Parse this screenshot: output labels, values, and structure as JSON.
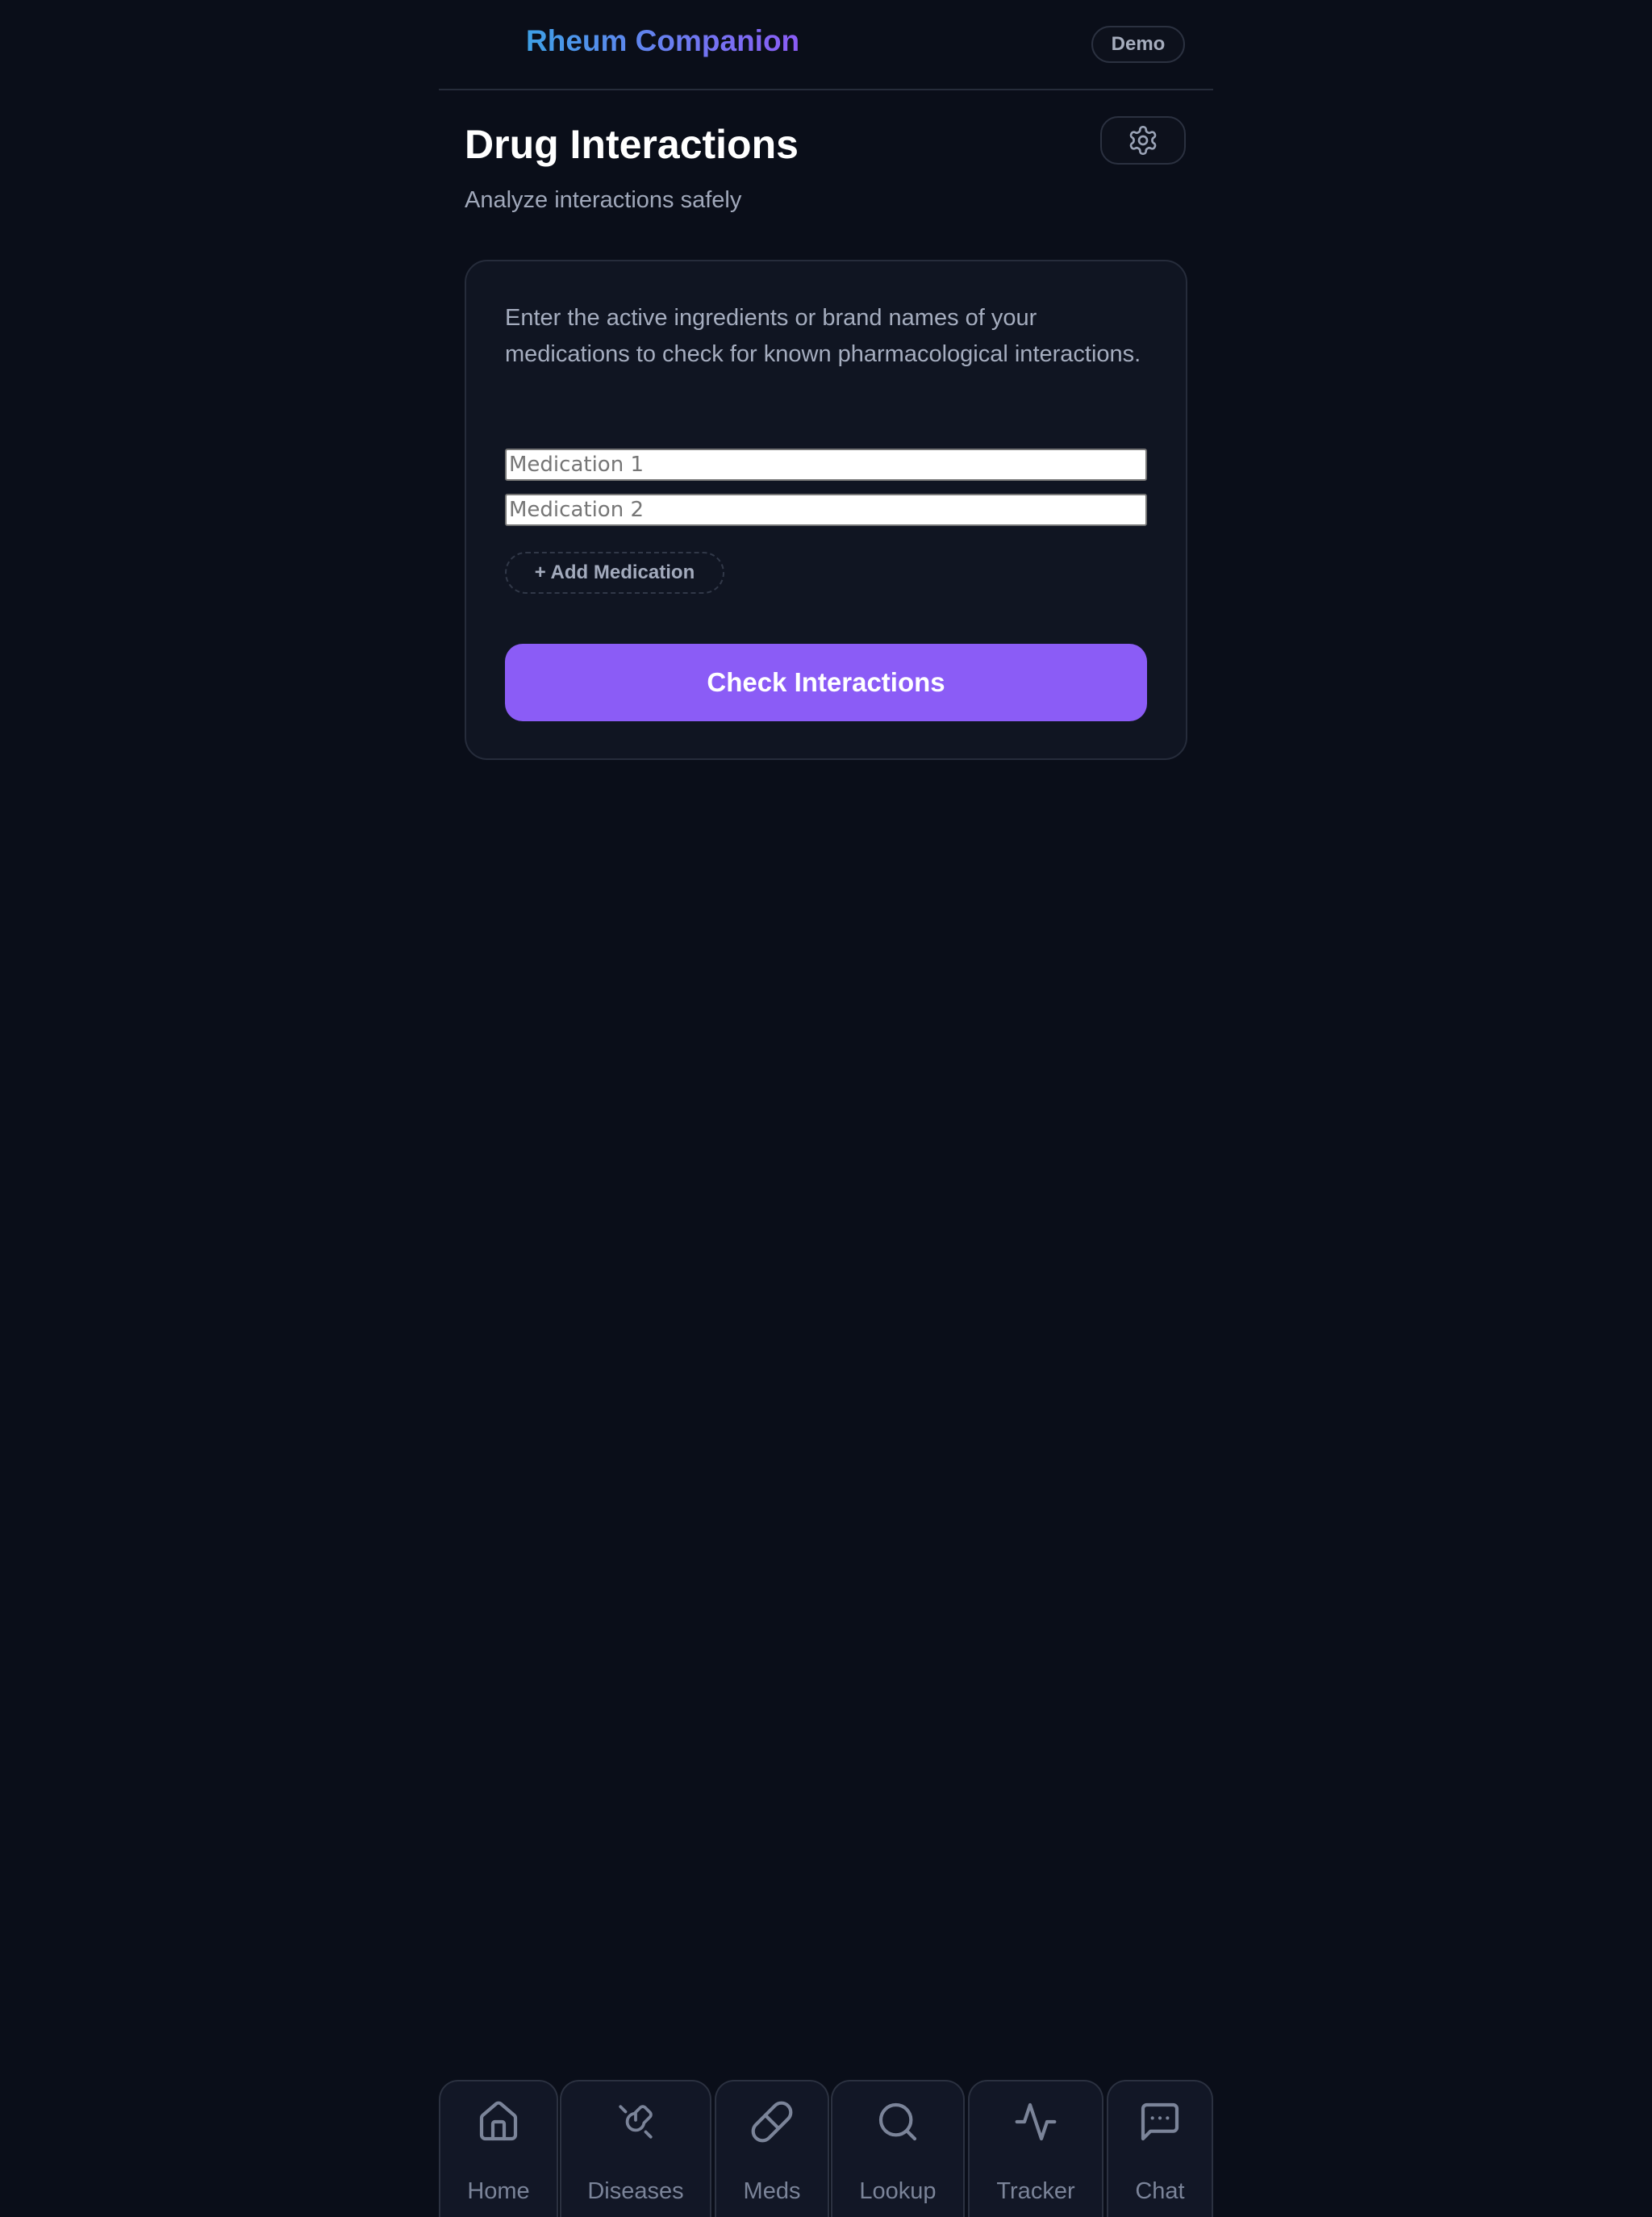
{
  "header": {
    "brand": "Rheum Companion",
    "demo_label": "Demo"
  },
  "page": {
    "title": "Drug Interactions",
    "subtitle": "Analyze interactions safely",
    "settings_icon": "gear-icon"
  },
  "card": {
    "description": "Enter the active ingredients or brand names of your medications to check for known pharmacological interactions.",
    "inputs": [
      {
        "placeholder": "Medication 1",
        "value": ""
      },
      {
        "placeholder": "Medication 2",
        "value": ""
      }
    ],
    "add_label": "+ Add Medication",
    "check_label": "Check Interactions"
  },
  "nav": {
    "items": [
      {
        "label": "Home",
        "icon": "home-icon"
      },
      {
        "label": "Diseases",
        "icon": "bandage-icon"
      },
      {
        "label": "Meds",
        "icon": "pill-icon"
      },
      {
        "label": "Lookup",
        "icon": "search-icon"
      },
      {
        "label": "Tracker",
        "icon": "activity-icon"
      },
      {
        "label": "Chat",
        "icon": "message-icon"
      }
    ]
  },
  "colors": {
    "background": "#0a0e19",
    "card": "#101522",
    "accent": "#8b5cf6",
    "brand_start": "#3ea0e6",
    "brand_end": "#8b5cf6"
  }
}
